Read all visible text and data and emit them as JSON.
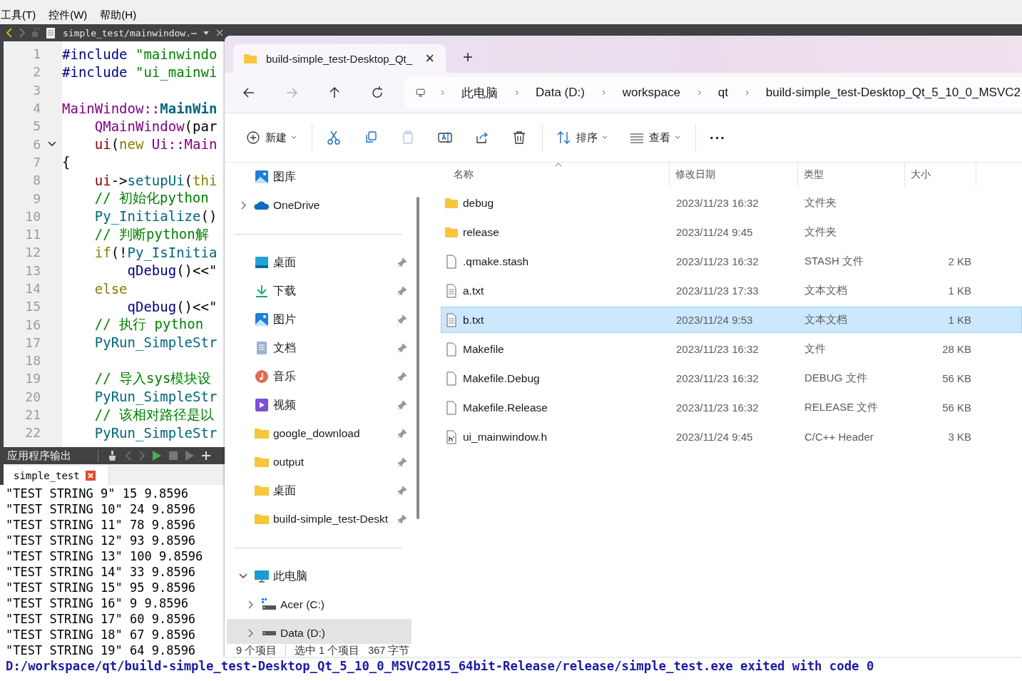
{
  "qt": {
    "menu": [
      "工具(T)",
      "控件(W)",
      "帮助(H)"
    ],
    "editor_tab": {
      "file": "simple_test/mainwindow.⋯"
    },
    "code": [
      {
        "number": "1",
        "fold": false,
        "segments": [
          {
            "kind": "preproc",
            "text": "#include "
          },
          {
            "kind": "string",
            "text": "\"mainwindo"
          }
        ]
      },
      {
        "number": "2",
        "fold": false,
        "segments": [
          {
            "kind": "preproc",
            "text": "#include "
          },
          {
            "kind": "string",
            "text": "\"ui_mainwi"
          }
        ]
      },
      {
        "number": "3",
        "fold": false
      },
      {
        "number": "4",
        "fold": false,
        "segments": [
          {
            "kind": "class",
            "text": "MainWindow::"
          },
          {
            "kind": "decl",
            "text": "MainWin"
          }
        ]
      },
      {
        "number": "5",
        "fold": false,
        "segments": [
          {
            "kind": "class",
            "text": "    QMainWindow"
          },
          {
            "kind": "plain",
            "text": "(par"
          }
        ]
      },
      {
        "number": "6",
        "fold": true,
        "segments": [
          {
            "kind": "member",
            "text": "    ui"
          },
          {
            "kind": "plain",
            "text": "("
          },
          {
            "kind": "keyword",
            "text": "new "
          },
          {
            "kind": "class",
            "text": "Ui::Main"
          }
        ]
      },
      {
        "number": "7",
        "fold": false,
        "segments": [
          {
            "kind": "plain",
            "text": "{"
          }
        ]
      },
      {
        "number": "8",
        "fold": false,
        "segments": [
          {
            "kind": "member",
            "text": "    ui"
          },
          {
            "kind": "plain",
            "text": "->"
          },
          {
            "kind": "func",
            "text": "setupUi"
          },
          {
            "kind": "plain",
            "text": "("
          },
          {
            "kind": "keyword",
            "text": "thi"
          }
        ]
      },
      {
        "number": "9",
        "fold": false,
        "segments": [
          {
            "kind": "comment",
            "text": "    // 初始化python"
          }
        ]
      },
      {
        "number": "10",
        "fold": false,
        "segments": [
          {
            "kind": "func",
            "text": "    Py_Initialize"
          },
          {
            "kind": "plain",
            "text": "()"
          }
        ]
      },
      {
        "number": "11",
        "fold": false,
        "segments": [
          {
            "kind": "comment",
            "text": "    // 判断python解"
          }
        ]
      },
      {
        "number": "12",
        "fold": false,
        "segments": [
          {
            "kind": "keyword",
            "text": "    if"
          },
          {
            "kind": "plain",
            "text": "(!"
          },
          {
            "kind": "func",
            "text": "Py_IsInitia"
          }
        ]
      },
      {
        "number": "13",
        "fold": false,
        "segments": [
          {
            "kind": "preproc",
            "text": "        qDebug"
          },
          {
            "kind": "plain",
            "text": "()<<\""
          }
        ]
      },
      {
        "number": "14",
        "fold": false,
        "segments": [
          {
            "kind": "keyword",
            "text": "    else"
          }
        ]
      },
      {
        "number": "15",
        "fold": false,
        "segments": [
          {
            "kind": "preproc",
            "text": "        qDebug"
          },
          {
            "kind": "plain",
            "text": "()<<\""
          }
        ]
      },
      {
        "number": "16",
        "fold": false,
        "segments": [
          {
            "kind": "comment",
            "text": "    // 执行 python"
          }
        ]
      },
      {
        "number": "17",
        "fold": false,
        "segments": [
          {
            "kind": "func",
            "text": "    PyRun_SimpleStr"
          }
        ]
      },
      {
        "number": "18",
        "fold": false
      },
      {
        "number": "19",
        "fold": false,
        "segments": [
          {
            "kind": "comment",
            "text": "    // 导入sys模块设"
          }
        ]
      },
      {
        "number": "20",
        "fold": false,
        "segments": [
          {
            "kind": "func",
            "text": "    PyRun_SimpleStr"
          }
        ]
      },
      {
        "number": "21",
        "fold": false,
        "segments": [
          {
            "kind": "comment",
            "text": "    // 该相对路径是以"
          }
        ]
      },
      {
        "number": "22",
        "fold": false,
        "segments": [
          {
            "kind": "func",
            "text": "    PyRun_SimpleStr"
          }
        ]
      }
    ],
    "output": {
      "title": "应用程序输出",
      "tab": "simple_test",
      "lines": [
        "\"TEST STRING 9\" 15 9.8596",
        "\"TEST STRING 10\" 24 9.8596",
        "\"TEST STRING 11\" 78 9.8596",
        "\"TEST STRING 12\" 93 9.8596",
        "\"TEST STRING 13\" 100 9.8596",
        "\"TEST STRING 14\" 33 9.8596",
        "\"TEST STRING 15\" 95 9.8596",
        "\"TEST STRING 16\" 9 9.8596",
        "\"TEST STRING 17\" 60 9.8596",
        "\"TEST STRING 18\" 67 9.8596",
        "\"TEST STRING 19\" 64 9.8596"
      ],
      "exit_line": "D:/workspace/qt/build-simple_test-Desktop_Qt_5_10_0_MSVC2015_64bit-Release/release/simple_test.exe exited with code 0"
    }
  },
  "explorer": {
    "tab": {
      "title": "build-simple_test-Desktop_Qt_",
      "close": "×"
    },
    "new_tab": "+",
    "nav_buttons": [
      {
        "kind": "back",
        "disabled": false
      },
      {
        "kind": "forward",
        "disabled": true
      },
      {
        "kind": "up",
        "disabled": false
      },
      {
        "kind": "refresh",
        "disabled": false
      }
    ],
    "breadcrumb": [
      "此电脑",
      "Data (D:)",
      "workspace",
      "qt",
      "build-simple_test-Desktop_Qt_5_10_0_MSVC2"
    ],
    "toolbar": [
      {
        "kind": "new",
        "label": "新建",
        "dropdown": true,
        "disabled": false
      },
      {
        "kind": "cut",
        "dropdown": false,
        "disabled": false
      },
      {
        "kind": "copy",
        "dropdown": false,
        "disabled": false
      },
      {
        "kind": "paste",
        "dropdown": false,
        "disabled": true
      },
      {
        "kind": "rename",
        "dropdown": false,
        "disabled": false
      },
      {
        "kind": "share",
        "dropdown": false,
        "disabled": false
      },
      {
        "kind": "delete",
        "dropdown": false,
        "disabled": false
      },
      {
        "kind": "sort",
        "label": "排序",
        "dropdown": true,
        "disabled": false
      },
      {
        "kind": "view",
        "label": "查看",
        "dropdown": true,
        "disabled": false
      },
      {
        "kind": "more",
        "label": "···",
        "dropdown": false,
        "disabled": false
      }
    ],
    "nav_sections": [
      [
        {
          "label": "图库",
          "kind": "gallery",
          "pinned": false,
          "selected": false
        },
        {
          "label": "OneDrive",
          "kind": "cloud",
          "pinned": false,
          "selected": false,
          "expanded": false
        }
      ],
      [
        {
          "label": "桌面",
          "kind": "desktop",
          "pinned": true,
          "selected": false
        },
        {
          "label": "下载",
          "kind": "download",
          "pinned": true,
          "selected": false
        },
        {
          "label": "图片",
          "kind": "gallery",
          "pinned": true,
          "selected": false
        },
        {
          "label": "文档",
          "kind": "document",
          "pinned": true,
          "selected": false
        },
        {
          "label": "音乐",
          "kind": "music",
          "pinned": true,
          "selected": false
        },
        {
          "label": "视频",
          "kind": "video",
          "pinned": true,
          "selected": false
        },
        {
          "label": "google_download",
          "kind": "folder",
          "pinned": true,
          "selected": false
        },
        {
          "label": "output",
          "kind": "folder",
          "pinned": true,
          "selected": false
        },
        {
          "label": "桌面",
          "kind": "folder",
          "pinned": true,
          "selected": false
        },
        {
          "label": "build-simple_test-Deskt",
          "kind": "folder",
          "pinned": true,
          "selected": false
        }
      ],
      [
        {
          "label": "此电脑",
          "kind": "pc",
          "pinned": false,
          "selected": false,
          "expanded": true,
          "children": [
            {
              "label": "Acer (C:)",
              "kind": "system-drive",
              "pinned": false,
              "selected": false,
              "expanded": false
            },
            {
              "label": "Data (D:)",
              "kind": "drive",
              "pinned": false,
              "selected": true,
              "expanded": false
            }
          ]
        }
      ]
    ],
    "columns": [
      {
        "label": "名称",
        "sorted": true
      },
      {
        "label": "修改日期",
        "sorted": false
      },
      {
        "label": "类型",
        "sorted": false
      },
      {
        "label": "大小",
        "sorted": false
      }
    ],
    "files": [
      {
        "name": "debug",
        "date": "2023/11/23 16:32",
        "type": "文件夹",
        "kind": "folder",
        "selected": false
      },
      {
        "name": "release",
        "date": "2023/11/24 9:45",
        "type": "文件夹",
        "kind": "folder",
        "selected": false
      },
      {
        "name": ".qmake.stash",
        "date": "2023/11/23 16:32",
        "type": "STASH 文件",
        "size": "2 KB",
        "kind": "file",
        "selected": false
      },
      {
        "name": "a.txt",
        "date": "2023/11/23 17:33",
        "type": "文本文档",
        "size": "1 KB",
        "kind": "text",
        "selected": false
      },
      {
        "name": "b.txt",
        "date": "2023/11/24 9:53",
        "type": "文本文档",
        "size": "1 KB",
        "kind": "text",
        "selected": true
      },
      {
        "name": "Makefile",
        "date": "2023/11/23 16:32",
        "type": "文件",
        "size": "28 KB",
        "kind": "file",
        "selected": false
      },
      {
        "name": "Makefile.Debug",
        "date": "2023/11/23 16:32",
        "type": "DEBUG 文件",
        "size": "56 KB",
        "kind": "file",
        "selected": false
      },
      {
        "name": "Makefile.Release",
        "date": "2023/11/23 16:32",
        "type": "RELEASE 文件",
        "size": "56 KB",
        "kind": "file",
        "selected": false
      },
      {
        "name": "ui_mainwindow.h",
        "date": "2023/11/24 9:45",
        "type": "C/C++ Header",
        "size": "3 KB",
        "kind": "header",
        "selected": false
      }
    ],
    "status": {
      "count": "9 个项目",
      "selection": "选中 1 个项目",
      "size": "367 字节"
    }
  }
}
